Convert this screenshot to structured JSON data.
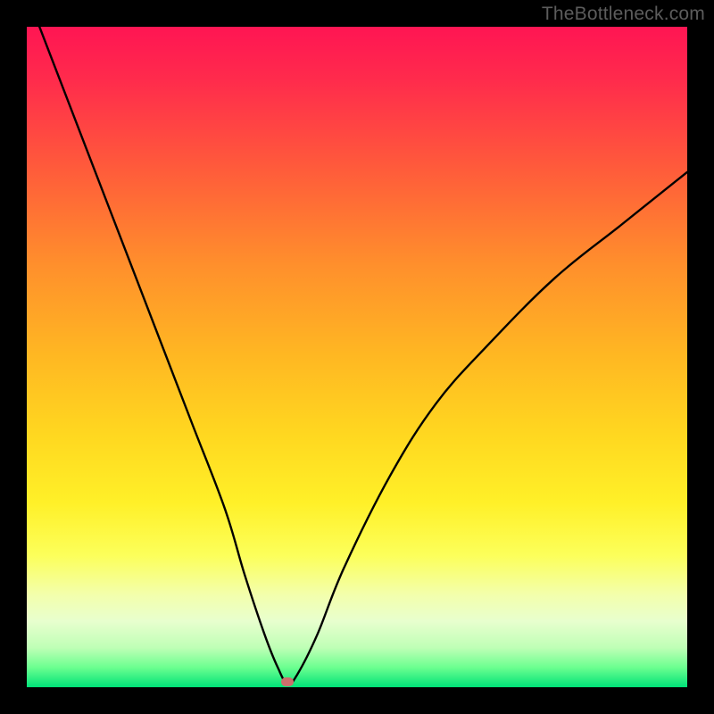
{
  "watermark": "TheBottleneck.com",
  "chart_data": {
    "type": "line",
    "title": "",
    "xlabel": "",
    "ylabel": "",
    "xlim": [
      0,
      100
    ],
    "ylim": [
      0,
      100
    ],
    "grid": false,
    "series": [
      {
        "name": "bottleneck-curve",
        "x": [
          0,
          5,
          10,
          15,
          20,
          25,
          30,
          33,
          36,
          38,
          39.5,
          41,
          44,
          48,
          55,
          62,
          70,
          80,
          90,
          100
        ],
        "y": [
          105,
          92,
          79,
          66,
          53,
          40,
          27,
          17,
          8,
          3,
          0.5,
          2,
          8,
          18,
          32,
          43,
          52,
          62,
          70,
          78
        ]
      }
    ],
    "marker": {
      "x": 39.5,
      "y": 0.8,
      "color": "#cc6f6c"
    },
    "background_gradient": {
      "stops": [
        {
          "pos": 0.0,
          "color": "#ff1553"
        },
        {
          "pos": 0.22,
          "color": "#ff5d3a"
        },
        {
          "pos": 0.5,
          "color": "#ffb822"
        },
        {
          "pos": 0.72,
          "color": "#fff028"
        },
        {
          "pos": 0.86,
          "color": "#f3ffac"
        },
        {
          "pos": 0.97,
          "color": "#6cff90"
        },
        {
          "pos": 1.0,
          "color": "#00e278"
        }
      ]
    }
  }
}
